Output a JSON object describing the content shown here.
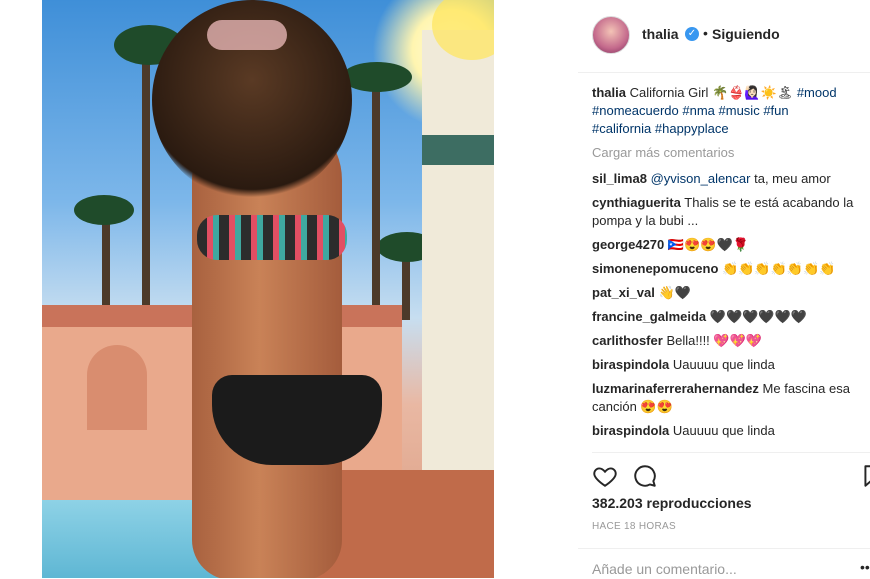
{
  "post": {
    "username": "thalia",
    "separator": "•",
    "follow_status": "Siguiendo",
    "verified_icon": "verified-badge-icon"
  },
  "caption": {
    "user": "thalia",
    "text": "California Girl 🌴👙🙋🏻‍♀️☀️🏝",
    "hashtags_line1": "#mood",
    "hashtags_line2": [
      "#nomeacuerdo",
      "#nma",
      "#music",
      "#fun"
    ],
    "hashtags_line3": [
      "#california",
      "#happyplace"
    ]
  },
  "load_more": "Cargar más comentarios",
  "comments": [
    {
      "user": "sil_lima8",
      "mention": "@yvison_alencar",
      "text": " ta, meu amor"
    },
    {
      "user": "cynthiaguerita",
      "text": "Thalis se te está acabando la pompa y la bubi ..."
    },
    {
      "user": "george4270",
      "text": "🇵🇷😍😍🖤🌹"
    },
    {
      "user": "simonenepomuceno",
      "text": "👏👏👏👏👏👏👏"
    },
    {
      "user": "pat_xi_val",
      "text": "👋🖤"
    },
    {
      "user": "francine_galmeida",
      "text": "🖤🖤🖤🖤🖤🖤"
    },
    {
      "user": "carlithosfer",
      "text": "Bella!!!! 💖💖💖"
    },
    {
      "user": "biraspindola",
      "text": "Uauuuu que linda"
    },
    {
      "user": "luzmarinaferrerahernandez",
      "text": "Me fascina esa canción 😍😍"
    },
    {
      "user": "biraspindola",
      "text": "Uauuuu que linda"
    }
  ],
  "stats": {
    "views": "382.203 reproducciones",
    "time": "HACE 18 HORAS"
  },
  "add_comment": {
    "placeholder": "Añade un comentario...",
    "more": "•••"
  },
  "colors": {
    "link": "#003569",
    "muted": "#999999",
    "verified": "#3897f0"
  }
}
